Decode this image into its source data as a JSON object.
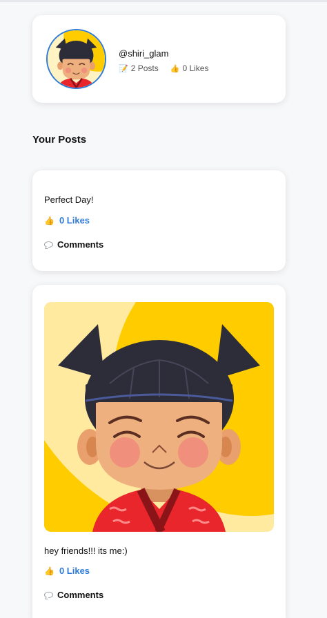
{
  "profile": {
    "username": "@shiri_glam",
    "posts_icon": "memo-icon",
    "posts_count": "2 Posts",
    "likes_icon": "thumbs-up-icon",
    "likes_count": "0 Likes"
  },
  "section": {
    "title": "Your Posts"
  },
  "posts": [
    {
      "text": "Perfect Day!",
      "likes_label": "0 Likes",
      "comments_label": "Comments",
      "has_image": false
    },
    {
      "text": "hey friends!!! its me:)",
      "likes_label": "0 Likes",
      "comments_label": "Comments",
      "has_image": true
    }
  ],
  "colors": {
    "accent": "#2f7bd8",
    "background": "#f7f8fa",
    "card": "#ffffff",
    "image_bg_yellow": "#ffcc00"
  }
}
